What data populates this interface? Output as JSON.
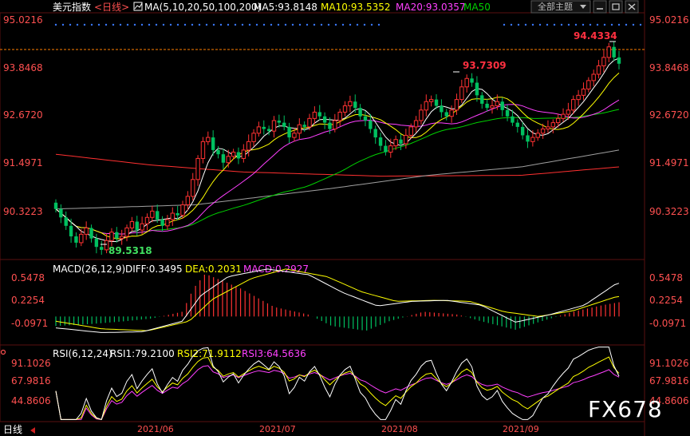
{
  "header": {
    "instrument": "美元指数",
    "period_label": "日线",
    "ma_set": "MA(5,10,20,50,100,200)",
    "ma5": "MA5:93.8148",
    "ma10": "MA10:93.5352",
    "ma20": "MA20:93.0357",
    "ma50": "MA50",
    "theme_label": "全部主题"
  },
  "bottom": {
    "period_label": "日线"
  },
  "watermark": "FX678",
  "colors": {
    "up": "#ff3232",
    "down": "#00c060",
    "ma5": "#ffffff",
    "ma10": "#ffff00",
    "ma20": "#ff40ff",
    "ma50": "#00d000",
    "ma100": "#a0a0a0",
    "ma200": "#ff3030",
    "axis_text": "#ff5050",
    "label_high": "#ff3040",
    "label_low": "#40e060",
    "macd_dea": "#ffff00",
    "macd_diff": "#ffffff",
    "macd_lbl": "#ff40ff"
  },
  "chart_data": [
    {
      "type": "candlestick",
      "yticks": [
        "95.0216",
        "93.8468",
        "92.6720",
        "91.4971",
        "90.3223"
      ],
      "ylim": [
        89.3,
        95.16
      ],
      "xticks": [
        "2021/06",
        "2021/07",
        "2021/08",
        "2021/09"
      ],
      "annotations": [
        {
          "text": "94.4334",
          "value": 94.4334
        },
        {
          "text": "93.7309",
          "value": 93.7309
        },
        {
          "text": "89.5318",
          "value": 89.5318
        }
      ],
      "ma_labels": {
        "ma5": "MA5",
        "ma10": "MA10",
        "ma20": "MA20",
        "ma50": "MA50",
        "ma100": "MA100",
        "ma200": "MA200"
      },
      "ma_anchors": {
        "ma100": [
          [
            0,
            90.5
          ],
          [
            60,
            90.6
          ],
          [
            120,
            91.0
          ],
          [
            160,
            91.3
          ],
          [
            200,
            91.5
          ],
          [
            242,
            91.9
          ]
        ],
        "ma200": [
          [
            0,
            91.8
          ],
          [
            40,
            91.55
          ],
          [
            80,
            91.38
          ],
          [
            140,
            91.28
          ],
          [
            200,
            91.3
          ],
          [
            242,
            91.5
          ]
        ]
      },
      "closes": [
        90.5,
        90.3,
        90.1,
        89.85,
        89.7,
        89.9,
        90.05,
        89.8,
        89.6,
        89.53,
        89.75,
        89.95,
        89.8,
        89.85,
        90.05,
        90.2,
        90.0,
        90.15,
        90.3,
        90.45,
        90.25,
        90.1,
        90.25,
        90.4,
        90.35,
        90.6,
        90.8,
        91.2,
        91.7,
        92.1,
        92.2,
        91.9,
        91.8,
        91.6,
        91.75,
        91.85,
        91.7,
        91.9,
        92.1,
        92.3,
        92.45,
        92.4,
        92.35,
        92.6,
        92.55,
        92.45,
        92.2,
        92.3,
        92.5,
        92.45,
        92.65,
        92.8,
        92.7,
        92.55,
        92.4,
        92.6,
        92.8,
        92.95,
        93.05,
        92.9,
        92.7,
        92.6,
        92.4,
        92.2,
        92.0,
        91.85,
        92.0,
        92.15,
        92.05,
        92.25,
        92.45,
        92.6,
        92.85,
        93.05,
        93.1,
        92.95,
        92.8,
        92.7,
        92.85,
        93.1,
        93.4,
        93.6,
        93.5,
        93.2,
        93.0,
        92.9,
        92.95,
        93.05,
        92.85,
        92.7,
        92.55,
        92.45,
        92.25,
        92.1,
        92.2,
        92.3,
        92.4,
        92.45,
        92.55,
        92.65,
        92.75,
        92.85,
        93.1,
        93.2,
        93.35,
        93.55,
        93.7,
        93.9,
        94.1,
        94.35,
        94.1,
        93.95
      ]
    },
    {
      "type": "macd",
      "label": "MACD(26,12,9)",
      "diff": "DIFF:0.3495",
      "dea": "DEA:0.2031",
      "macd": "MACD:0.2927",
      "yticks": [
        "0.5478",
        "0.2254",
        "-0.0971"
      ],
      "ylim": [
        -0.3,
        0.6
      ],
      "diff_anchors": [
        [
          0,
          -0.12
        ],
        [
          20,
          -0.17
        ],
        [
          38,
          -0.16
        ],
        [
          55,
          -0.05
        ],
        [
          63,
          0.22
        ],
        [
          75,
          0.42
        ],
        [
          92,
          0.5
        ],
        [
          110,
          0.44
        ],
        [
          125,
          0.25
        ],
        [
          140,
          0.11
        ],
        [
          155,
          0.16
        ],
        [
          170,
          0.17
        ],
        [
          185,
          0.12
        ],
        [
          200,
          -0.06
        ],
        [
          215,
          0.02
        ],
        [
          230,
          0.12
        ],
        [
          244,
          0.35
        ]
      ],
      "dea_anchors": [
        [
          0,
          -0.05
        ],
        [
          20,
          -0.13
        ],
        [
          40,
          -0.15
        ],
        [
          58,
          -0.05
        ],
        [
          68,
          0.18
        ],
        [
          85,
          0.4
        ],
        [
          100,
          0.5
        ],
        [
          118,
          0.42
        ],
        [
          133,
          0.26
        ],
        [
          148,
          0.16
        ],
        [
          165,
          0.17
        ],
        [
          180,
          0.16
        ],
        [
          195,
          0.05
        ],
        [
          210,
          0.0
        ],
        [
          225,
          0.06
        ],
        [
          244,
          0.21
        ]
      ],
      "hist_anchors": [
        [
          0,
          -0.1
        ],
        [
          15,
          -0.08
        ],
        [
          30,
          -0.05
        ],
        [
          42,
          -0.02
        ],
        [
          55,
          0.05
        ],
        [
          60,
          0.3
        ],
        [
          65,
          0.45
        ],
        [
          80,
          0.3
        ],
        [
          95,
          0.1
        ],
        [
          110,
          0.02
        ],
        [
          120,
          -0.1
        ],
        [
          135,
          -0.15
        ],
        [
          145,
          -0.05
        ],
        [
          160,
          0.05
        ],
        [
          175,
          0.02
        ],
        [
          185,
          -0.05
        ],
        [
          200,
          -0.14
        ],
        [
          210,
          -0.06
        ],
        [
          225,
          0.05
        ],
        [
          238,
          0.12
        ],
        [
          245,
          0.15
        ]
      ]
    },
    {
      "type": "rsi",
      "label": "RSI(6,12,24)",
      "rsi1": "RSI1:79.2100",
      "rsi2": "RSI2:71.9112",
      "rsi3": "RSI3:64.5636",
      "yticks": [
        "91.1026",
        "67.9816",
        "44.8606"
      ],
      "ylim": [
        20,
        95
      ]
    }
  ]
}
